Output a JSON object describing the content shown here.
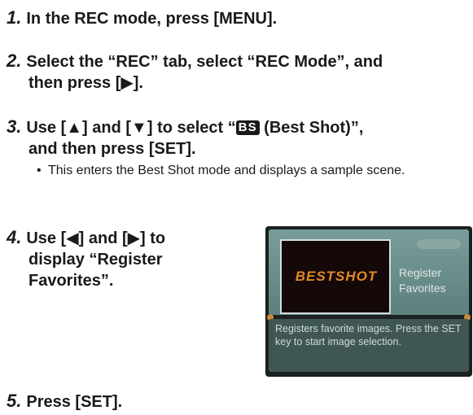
{
  "steps": [
    {
      "num": "1.",
      "line1": "In the REC mode, press [MENU]."
    },
    {
      "num": "2.",
      "line1": "Select the “REC” tab, select “REC Mode”, and",
      "line2": "then press [▶]."
    },
    {
      "num": "3.",
      "line1_pre": "Use [▲] and [▼] to select “",
      "badge": "BS",
      "line1_post": " (Best Shot)”,",
      "line2": "and then press [SET]."
    },
    {
      "num": "4.",
      "line1": "Use [◀] and [▶] to",
      "line2": "display “Register",
      "line3": "Favorites”."
    },
    {
      "num": "5.",
      "line1": "Press [SET]."
    }
  ],
  "bullet": {
    "symbol": "•",
    "text": "This enters the Best Shot mode and displays a sample scene."
  },
  "lcd": {
    "preview_text": "BESTSHOT",
    "label_line1": "Register",
    "label_line2": "Favorites",
    "description": "Registers favorite images. Press the SET key to start image selection."
  }
}
